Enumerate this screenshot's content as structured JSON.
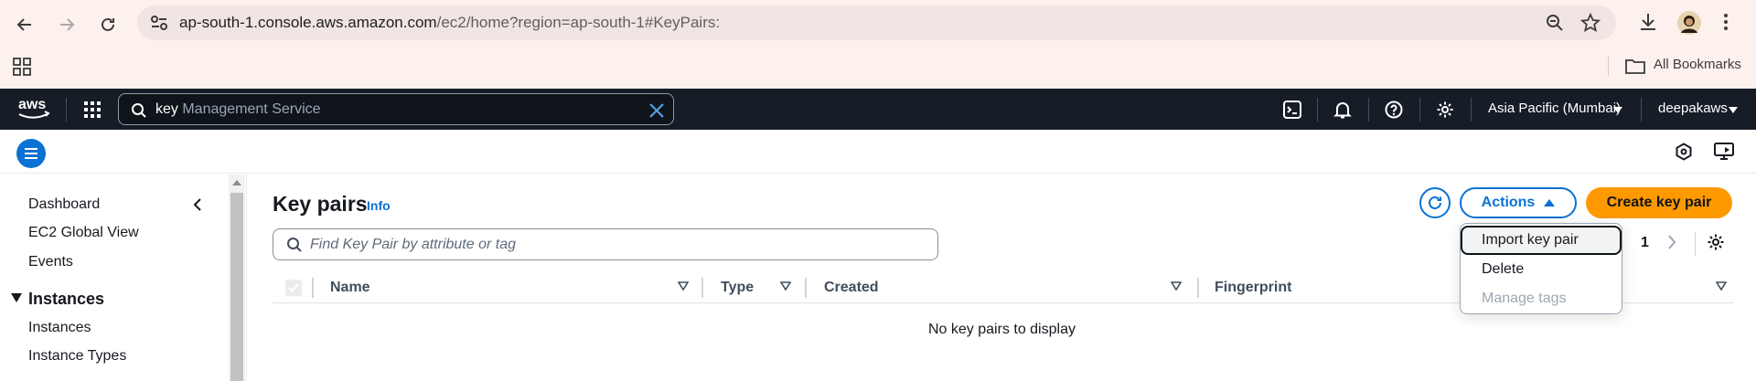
{
  "browser": {
    "url_host": "ap-south-1.console.aws.amazon.com",
    "url_path": "/ec2/home?region=ap-south-1#KeyPairs:",
    "bookmarks_label": "All Bookmarks"
  },
  "aws_nav": {
    "logo": "aws",
    "search_value": "key",
    "search_hint": " Management Service",
    "region": "Asia Pacific (Mumbai)",
    "account": "deepakaws"
  },
  "sidebar": {
    "items": [
      "Dashboard",
      "EC2 Global View",
      "Events"
    ],
    "section": "Instances",
    "section_items": [
      "Instances",
      "Instance Types"
    ]
  },
  "main": {
    "title": "Key pairs",
    "info": "Info",
    "actions_label": "Actions",
    "create_label": "Create key pair",
    "filter_placeholder": "Find Key Pair by attribute or tag",
    "page_number": "1",
    "columns": [
      "Name",
      "Type",
      "Created",
      "Fingerprint"
    ],
    "empty_message": "No key pairs to display"
  },
  "actions_menu": {
    "items": [
      "Import key pair",
      "Delete",
      "Manage tags"
    ]
  },
  "colors": {
    "aws_nav_bg": "#161d26",
    "primary": "#0972d3",
    "create_button": "#ff9900"
  }
}
